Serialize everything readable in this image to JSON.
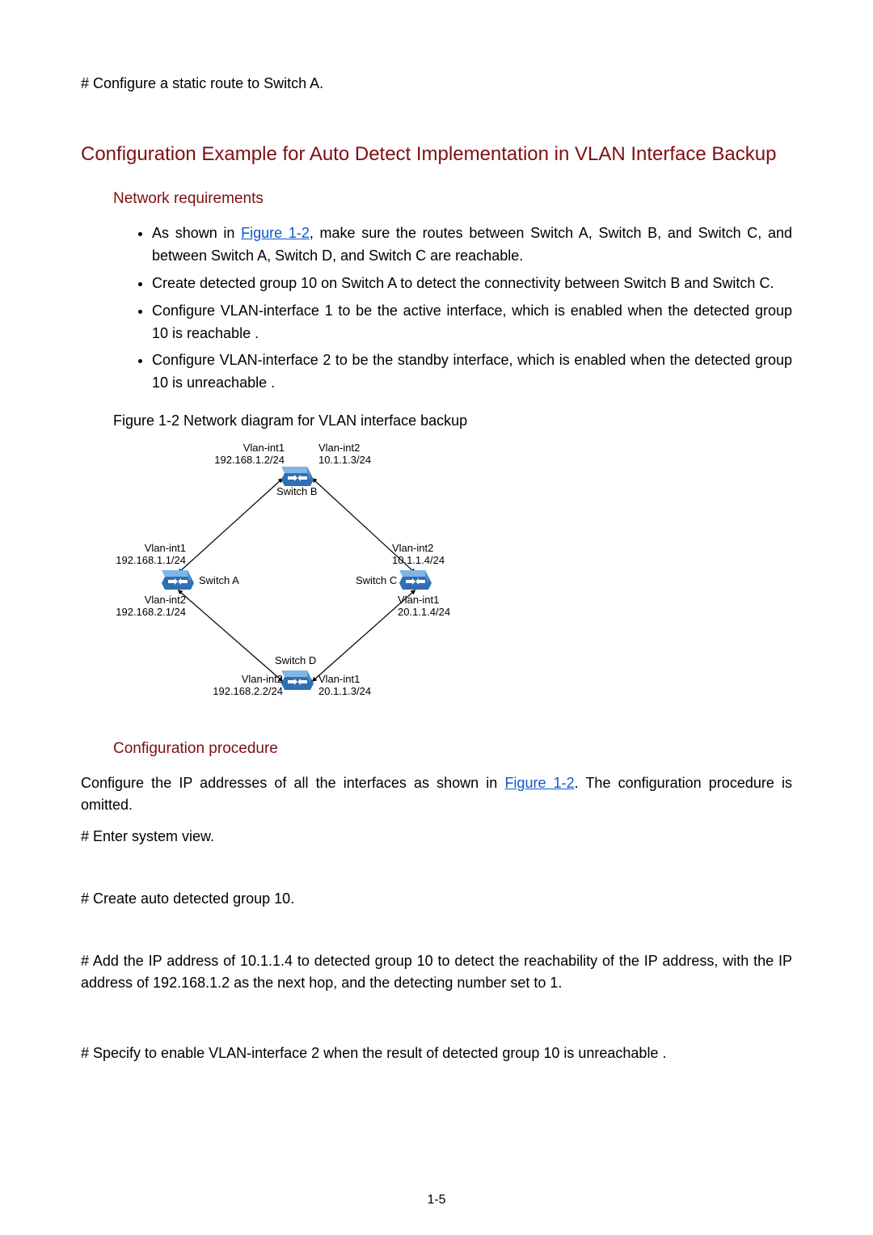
{
  "top_note": "# Configure a static route to Switch A.",
  "section_title": "Configuration Example for Auto Detect     Implementation in VLAN Interface Backup",
  "netreq_heading": "Network requirements",
  "req_intro_prefix": "As shown in ",
  "req_intro_link": "Figure 1-2",
  "req_intro_suffix": ", make sure the routes between Switch A, Switch B, and Switch C, and between Switch A, Switch D, and Switch C are reachable.",
  "req2": "Create detected group 10 on Switch A to detect the connectivity between Switch B and Switch C.",
  "req3": "Configure VLAN-interface 1 to be the active interface, which is enabled when the detected group 10 is reachable .",
  "req4": "Configure VLAN-interface 2 to be the standby interface, which is enabled when the detected group 10 is unreachable .",
  "figure_caption": "Figure 1-2  Network diagram for VLAN interface backup",
  "diagram": {
    "switch_a": "Switch A",
    "switch_b": "Switch B",
    "switch_c": "Switch C",
    "switch_d": "Switch D",
    "a_v1": "Vlan-int1\n192.168.1.1/24",
    "a_v2": "Vlan-int2\n192.168.2.1/24",
    "b_v1": "Vlan-int1\n192.168.1.2/24",
    "b_v2": "Vlan-int2\n10.1.1.3/24",
    "c_v2": "Vlan-int2\n10.1.1.4/24",
    "c_v1": "Vlan-int1\n20.1.1.4/24",
    "d_v2": "Vlan-int2\n192.168.2.2/24",
    "d_v1": "Vlan-int1\n20.1.1.3/24"
  },
  "confproc_heading": "Configuration procedure",
  "confproc_intro_prefix": "Configure the IP addresses of all the interfaces as shown in ",
  "confproc_intro_link": "Figure 1-2",
  "confproc_intro_suffix": ". The configuration procedure is omitted.",
  "step1": "# Enter system view.",
  "step2": "# Create auto detected group 10.",
  "step3": "# Add the IP address of 10.1.1.4 to detected group 10 to detect the reachability of the IP address, with the IP address of 192.168.1.2 as the next hop, and the detecting number set to 1.",
  "step4": "# Specify to enable VLAN-interface 2 when the result of detected group 10 is unreachable .",
  "page_number": "1-5"
}
